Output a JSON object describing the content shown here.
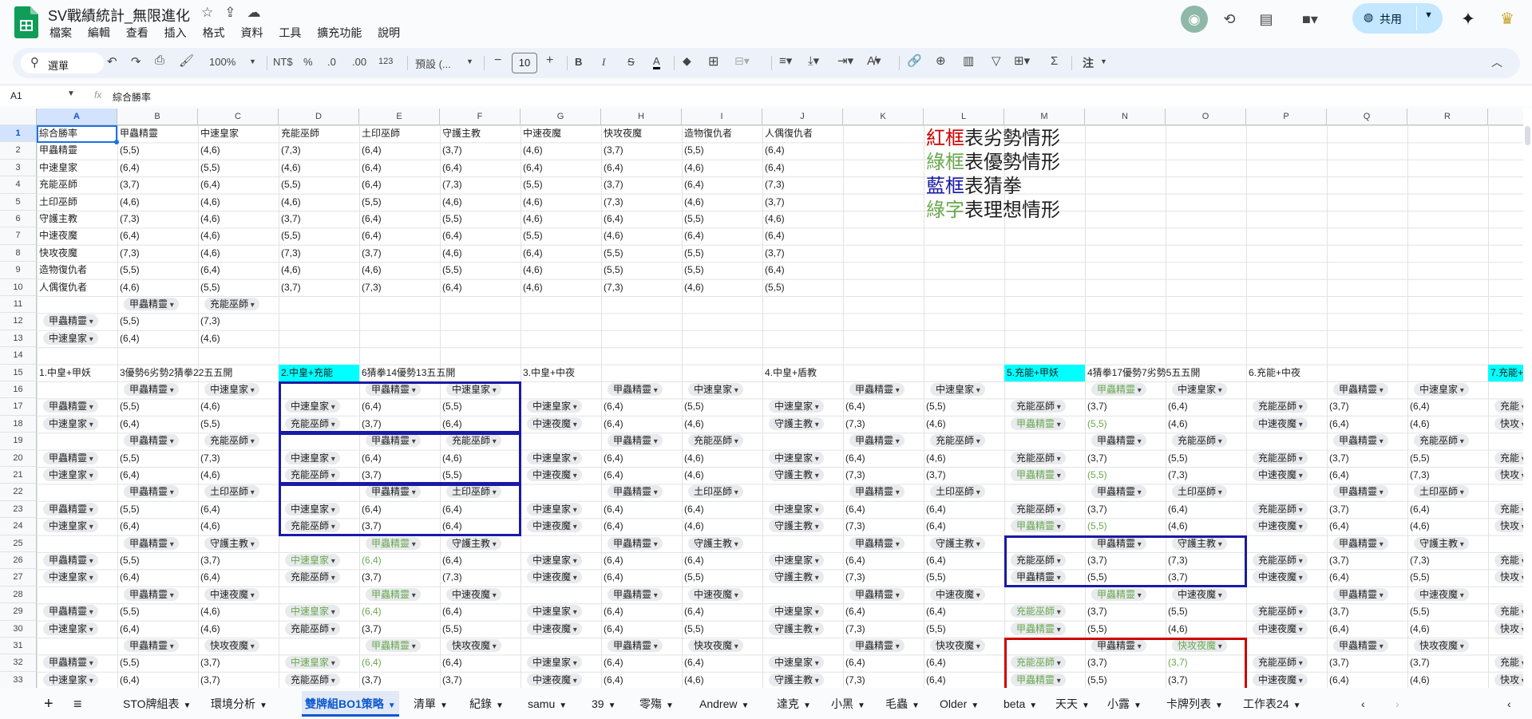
{
  "doc": {
    "title": "SV戰績統計_無限進化",
    "menus": [
      "檔案",
      "編輯",
      "查看",
      "插入",
      "格式",
      "資料",
      "工具",
      "擴充功能",
      "說明"
    ],
    "share_label": "共用"
  },
  "toolbar": {
    "search_label": "選單",
    "zoom": "100%",
    "currency": "NT$",
    "percent": "%",
    "dec_decrease": ".0",
    "dec_increase": ".00",
    "number_format": "123",
    "font": "預設 (...",
    "font_size": "10",
    "bold": "B",
    "italic": "I",
    "strike": "S",
    "text_color": "A",
    "sigma": "Σ",
    "note": "注"
  },
  "formula_bar": {
    "name_box": "A1",
    "fx": "fx",
    "content": "綜合勝率"
  },
  "columns": [
    "A",
    "B",
    "C",
    "D",
    "E",
    "F",
    "G",
    "H",
    "I",
    "J",
    "K",
    "L",
    "M",
    "N",
    "O",
    "P",
    "Q",
    "R"
  ],
  "rows": [
    "1",
    "2",
    "3",
    "4",
    "5",
    "6",
    "7",
    "8",
    "9",
    "10",
    "11",
    "12",
    "13",
    "14",
    "15",
    "16",
    "17",
    "18",
    "19",
    "20",
    "21",
    "22",
    "23",
    "24",
    "25",
    "26",
    "27",
    "28",
    "29",
    "30",
    "31",
    "32",
    "33"
  ],
  "cells": {
    "A1": "綜合勝率",
    "B1": "甲蟲精靈",
    "C1": "中速皇家",
    "D1": "充能巫師",
    "E1": "土印巫師",
    "F1": "守護主教",
    "G1": "中速夜魔",
    "H1": "快攻夜魔",
    "I1": "造物復仇者",
    "J1": "人偶復仇者",
    "A2": "甲蟲精靈",
    "B2": "(5,5)",
    "C2": "(4,6)",
    "D2": "(7,3)",
    "E2": "(6,4)",
    "F2": "(3,7)",
    "G2": "(4,6)",
    "H2": "(3,7)",
    "I2": "(5,5)",
    "J2": "(6,4)",
    "A3": "中速皇家",
    "B3": "(6,4)",
    "C3": "(5,5)",
    "D3": "(4,6)",
    "E3": "(6,4)",
    "F3": "(6,4)",
    "G3": "(6,4)",
    "H3": "(6,4)",
    "I3": "(4,6)",
    "J3": "(6,4)",
    "A4": "充能巫師",
    "B4": "(3,7)",
    "C4": "(6,4)",
    "D4": "(5,5)",
    "E4": "(6,4)",
    "F4": "(7,3)",
    "G4": "(5,5)",
    "H4": "(3,7)",
    "I4": "(6,4)",
    "J4": "(7,3)",
    "A5": "土印巫師",
    "B5": "(4,6)",
    "C5": "(4,6)",
    "D5": "(4,6)",
    "E5": "(5,5)",
    "F5": "(4,6)",
    "G5": "(4,6)",
    "H5": "(7,3)",
    "I5": "(4,6)",
    "J5": "(3,7)",
    "A6": "守護主教",
    "B6": "(7,3)",
    "C6": "(4,6)",
    "D6": "(3,7)",
    "E6": "(6,4)",
    "F6": "(5,5)",
    "G6": "(4,6)",
    "H6": "(6,4)",
    "I6": "(5,5)",
    "J6": "(4,6)",
    "A7": "中速夜魔",
    "B7": "(6,4)",
    "C7": "(4,6)",
    "D7": "(5,5)",
    "E7": "(6,4)",
    "F7": "(6,4)",
    "G7": "(5,5)",
    "H7": "(4,6)",
    "I7": "(6,4)",
    "J7": "(6,4)",
    "A8": "快攻夜魔",
    "B8": "(7,3)",
    "C8": "(4,6)",
    "D8": "(7,3)",
    "E8": "(3,7)",
    "F8": "(4,6)",
    "G8": "(6,4)",
    "H8": "(5,5)",
    "I8": "(5,5)",
    "J8": "(3,7)",
    "A9": "造物復仇者",
    "B9": "(5,5)",
    "C9": "(6,4)",
    "D9": "(4,6)",
    "E9": "(4,6)",
    "F9": "(5,5)",
    "G9": "(4,6)",
    "H9": "(5,5)",
    "I9": "(5,5)",
    "J9": "(6,4)",
    "A10": "人偶復仇者",
    "B10": "(4,6)",
    "C10": "(5,5)",
    "D10": "(3,7)",
    "E10": "(7,3)",
    "F10": "(6,4)",
    "G10": "(4,6)",
    "H10": "(7,3)",
    "I10": "(4,6)",
    "J10": "(5,5)",
    "B12": "(5,5)",
    "C12": "(7,3)",
    "B13": "(6,4)",
    "C13": "(4,6)",
    "A15": "1.中皇+甲妖",
    "B15": "3優勢6劣勢2猜拳22五五開",
    "D15": "2.中皇+充能",
    "E15": "6猜拳14優勢13五五開",
    "G15": "3.中皇+中夜",
    "J15": "4.中皇+盾教",
    "M15": "5.充能+甲妖",
    "N15": "4猜拳17優勢7劣勢5五五開",
    "P15": "6.充能+中夜",
    "S15": "7.充能+",
    "B17": "(5,5)",
    "C17": "(4,6)",
    "E17": "(6,4)",
    "F17": "(5,5)",
    "H17": "(6,4)",
    "I17": "(5,5)",
    "K17": "(6,4)",
    "L17": "(5,5)",
    "N17": "(3,7)",
    "O17": "(6,4)",
    "Q17": "(3,7)",
    "R17": "(6,4)",
    "B18": "(6,4)",
    "C18": "(5,5)",
    "E18": "(3,7)",
    "F18": "(6,4)",
    "H18": "(6,4)",
    "I18": "(4,6)",
    "K18": "(7,3)",
    "L18": "(4,6)",
    "N18": "(5,5)",
    "O18": "(4,6)",
    "Q18": "(6,4)",
    "R18": "(4,6)",
    "B20": "(5,5)",
    "C20": "(7,3)",
    "E20": "(6,4)",
    "F20": "(4,6)",
    "H20": "(6,4)",
    "I20": "(4,6)",
    "K20": "(6,4)",
    "L20": "(4,6)",
    "N20": "(3,7)",
    "O20": "(5,5)",
    "Q20": "(3,7)",
    "R20": "(5,5)",
    "B21": "(6,4)",
    "C21": "(4,6)",
    "E21": "(3,7)",
    "F21": "(5,5)",
    "H21": "(6,4)",
    "I21": "(4,6)",
    "K21": "(7,3)",
    "L21": "(3,7)",
    "N21": "(5,5)",
    "O21": "(7,3)",
    "Q21": "(6,4)",
    "R21": "(7,3)",
    "B23": "(5,5)",
    "C23": "(6,4)",
    "E23": "(6,4)",
    "F23": "(6,4)",
    "H23": "(6,4)",
    "I23": "(6,4)",
    "K23": "(6,4)",
    "L23": "(6,4)",
    "N23": "(3,7)",
    "O23": "(6,4)",
    "Q23": "(3,7)",
    "R23": "(6,4)",
    "B24": "(6,4)",
    "C24": "(4,6)",
    "E24": "(3,7)",
    "F24": "(6,4)",
    "H24": "(6,4)",
    "I24": "(4,6)",
    "K24": "(7,3)",
    "L24": "(6,4)",
    "N24": "(5,5)",
    "O24": "(4,6)",
    "Q24": "(6,4)",
    "R24": "(4,6)",
    "B26": "(5,5)",
    "C26": "(3,7)",
    "E26": "(6,4)",
    "F26": "(6,4)",
    "H26": "(6,4)",
    "I26": "(6,4)",
    "K26": "(6,4)",
    "L26": "(6,4)",
    "N26": "(3,7)",
    "O26": "(7,3)",
    "Q26": "(3,7)",
    "R26": "(7,3)",
    "B27": "(6,4)",
    "C27": "(6,4)",
    "E27": "(3,7)",
    "F27": "(7,3)",
    "H27": "(6,4)",
    "I27": "(5,5)",
    "K27": "(7,3)",
    "L27": "(5,5)",
    "N27": "(5,5)",
    "O27": "(3,7)",
    "Q27": "(6,4)",
    "R27": "(5,5)",
    "B29": "(5,5)",
    "C29": "(4,6)",
    "E29": "(6,4)",
    "F29": "(6,4)",
    "H29": "(6,4)",
    "I29": "(6,4)",
    "K29": "(6,4)",
    "L29": "(6,4)",
    "N29": "(3,7)",
    "O29": "(5,5)",
    "Q29": "(3,7)",
    "R29": "(5,5)",
    "B30": "(6,4)",
    "C30": "(4,6)",
    "E30": "(3,7)",
    "F30": "(5,5)",
    "H30": "(6,4)",
    "I30": "(5,5)",
    "K30": "(7,3)",
    "L30": "(5,5)",
    "N30": "(5,5)",
    "O30": "(4,6)",
    "Q30": "(6,4)",
    "R30": "(4,6)",
    "B32": "(5,5)",
    "C32": "(3,7)",
    "E32": "(6,4)",
    "F32": "(6,4)",
    "H32": "(6,4)",
    "I32": "(6,4)",
    "K32": "(6,4)",
    "L32": "(6,4)",
    "N32": "(3,7)",
    "O32": "(3,7)",
    "Q32": "(3,7)",
    "R32": "(3,7)",
    "B33": "(6,4)",
    "C33": "(3,7)",
    "E33": "(3,7)",
    "F33": "(3,7)",
    "H33": "(6,4)",
    "I33": "(4,6)",
    "K33": "(7,3)",
    "L33": "(6,4)",
    "N33": "(5,5)",
    "O33": "(3,7)",
    "Q33": "(6,4)",
    "R33": "(4,6)"
  },
  "green_cells": [
    "E26",
    "E29",
    "E32",
    "N18",
    "N21",
    "N24",
    "O32"
  ],
  "chips": {
    "B11": "甲蟲精靈",
    "C11": "充能巫師",
    "A12": "甲蟲精靈",
    "A13": "中速皇家",
    "B16": "甲蟲精靈",
    "C16": "中速皇家",
    "E16": "甲蟲精靈",
    "F16": "中速皇家",
    "H16": "甲蟲精靈",
    "I16": "中速皇家",
    "K16": "甲蟲精靈",
    "L16": "中速皇家",
    "N16": "甲蟲精靈",
    "O16": "中速皇家",
    "Q16": "甲蟲精靈",
    "R16": "中速皇家",
    "A17": "甲蟲精靈",
    "D17": "中速皇家",
    "G17": "中速皇家",
    "J17": "中速皇家",
    "M17": "充能巫師",
    "P17": "充能巫師",
    "S17": "充能",
    "A18": "中速皇家",
    "D18": "充能巫師",
    "G18": "中速夜魔",
    "J18": "守護主教",
    "M18": "甲蟲精靈",
    "P18": "中速夜魔",
    "S18": "快攻",
    "B19": "甲蟲精靈",
    "C19": "充能巫師",
    "E19": "甲蟲精靈",
    "F19": "充能巫師",
    "H19": "甲蟲精靈",
    "I19": "充能巫師",
    "K19": "甲蟲精靈",
    "L19": "充能巫師",
    "N19": "甲蟲精靈",
    "O19": "充能巫師",
    "Q19": "甲蟲精靈",
    "R19": "充能巫師",
    "A20": "甲蟲精靈",
    "D20": "中速皇家",
    "G20": "中速皇家",
    "J20": "中速皇家",
    "M20": "充能巫師",
    "P20": "充能巫師",
    "S20": "充能",
    "A21": "中速皇家",
    "D21": "充能巫師",
    "G21": "中速夜魔",
    "J21": "守護主教",
    "M21": "甲蟲精靈",
    "P21": "中速夜魔",
    "S21": "快攻",
    "B22": "甲蟲精靈",
    "C22": "土印巫師",
    "E22": "甲蟲精靈",
    "F22": "土印巫師",
    "H22": "甲蟲精靈",
    "I22": "土印巫師",
    "K22": "甲蟲精靈",
    "L22": "土印巫師",
    "N22": "甲蟲精靈",
    "O22": "土印巫師",
    "Q22": "甲蟲精靈",
    "R22": "土印巫師",
    "A23": "甲蟲精靈",
    "D23": "中速皇家",
    "G23": "中速皇家",
    "J23": "中速皇家",
    "M23": "充能巫師",
    "P23": "充能巫師",
    "S23": "充能",
    "A24": "中速皇家",
    "D24": "充能巫師",
    "G24": "中速夜魔",
    "J24": "守護主教",
    "M24": "甲蟲精靈",
    "P24": "中速夜魔",
    "S24": "快攻",
    "B25": "甲蟲精靈",
    "C25": "守護主教",
    "E25": "甲蟲精靈",
    "F25": "守護主教",
    "H25": "甲蟲精靈",
    "I25": "守護主教",
    "K25": "甲蟲精靈",
    "L25": "守護主教",
    "N25": "甲蟲精靈",
    "O25": "守護主教",
    "Q25": "甲蟲精靈",
    "R25": "守護主教",
    "A26": "甲蟲精靈",
    "D26": "中速皇家",
    "G26": "中速皇家",
    "J26": "中速皇家",
    "M26": "充能巫師",
    "P26": "充能巫師",
    "S26": "充能",
    "A27": "中速皇家",
    "D27": "充能巫師",
    "G27": "中速夜魔",
    "J27": "守護主教",
    "M27": "甲蟲精靈",
    "P27": "中速夜魔",
    "S27": "快攻",
    "B28": "甲蟲精靈",
    "C28": "中速夜魔",
    "E28": "甲蟲精靈",
    "F28": "中速夜魔",
    "H28": "甲蟲精靈",
    "I28": "中速夜魔",
    "K28": "甲蟲精靈",
    "L28": "中速夜魔",
    "N28": "甲蟲精靈",
    "O28": "中速夜魔",
    "Q28": "甲蟲精靈",
    "R28": "中速夜魔",
    "A29": "甲蟲精靈",
    "D29": "中速皇家",
    "G29": "中速皇家",
    "J29": "中速皇家",
    "M29": "充能巫師",
    "P29": "充能巫師",
    "S29": "充能",
    "A30": "中速皇家",
    "D30": "充能巫師",
    "G30": "中速夜魔",
    "J30": "守護主教",
    "M30": "甲蟲精靈",
    "P30": "中速夜魔",
    "S30": "快攻",
    "B31": "甲蟲精靈",
    "C31": "快攻夜魔",
    "E31": "甲蟲精靈",
    "F31": "快攻夜魔",
    "H31": "甲蟲精靈",
    "I31": "快攻夜魔",
    "K31": "甲蟲精靈",
    "L31": "快攻夜魔",
    "N31": "甲蟲精靈",
    "O31": "快攻夜魔",
    "Q31": "甲蟲精靈",
    "R31": "快攻夜魔",
    "A32": "甲蟲精靈",
    "D32": "中速皇家",
    "G32": "中速皇家",
    "J32": "中速皇家",
    "M32": "充能巫師",
    "P32": "充能巫師",
    "S32": "充能",
    "A33": "中速皇家",
    "D33": "充能巫師",
    "G33": "中速夜魔",
    "J33": "守護主教",
    "M33": "甲蟲精靈",
    "P33": "中速夜魔",
    "S33": "快攻"
  },
  "green_chips": [
    "D26",
    "D29",
    "D32",
    "E25",
    "E28",
    "E31",
    "M18",
    "M21",
    "M24",
    "M29",
    "M30",
    "M32",
    "N16",
    "N28",
    "O31",
    "M33"
  ],
  "legend": [
    {
      "key": "紅框",
      "key_color": "#cc0000",
      "text": "表劣勢情形"
    },
    {
      "key": "綠框",
      "key_color": "#6aa84f",
      "text": "表優勢情形"
    },
    {
      "key": "藍框",
      "key_color": "#1a1aa6",
      "text": "表猜拳"
    },
    {
      "key": "綠字",
      "key_color": "#6aa84f",
      "text": "表理想情形"
    }
  ],
  "sheet_tabs": [
    {
      "label": "STO牌組表",
      "active": false
    },
    {
      "label": "環境分析",
      "active": false
    },
    {
      "label": "雙牌組BO1策略",
      "active": true
    },
    {
      "label": "清單",
      "active": false
    },
    {
      "label": "紀錄",
      "active": false
    },
    {
      "label": "samu",
      "active": false
    },
    {
      "label": "39",
      "active": false
    },
    {
      "label": "零殤",
      "active": false
    },
    {
      "label": "Andrew",
      "active": false
    },
    {
      "label": "達克",
      "active": false
    },
    {
      "label": "小黑",
      "active": false
    },
    {
      "label": "毛蟲",
      "active": false
    },
    {
      "label": "Older",
      "active": false
    },
    {
      "label": "beta",
      "active": false
    },
    {
      "label": "天天",
      "active": false
    },
    {
      "label": "小露",
      "active": false
    },
    {
      "label": "卡牌列表",
      "active": false
    },
    {
      "label": "工作表24",
      "active": false
    }
  ],
  "colors": {
    "accent": "#0b57d0",
    "share_bg": "#c2e7ff",
    "highlight": "#00ffff",
    "box_blue": "#1a1aa6",
    "box_red": "#cc0000",
    "green_text": "#6aa84f"
  }
}
